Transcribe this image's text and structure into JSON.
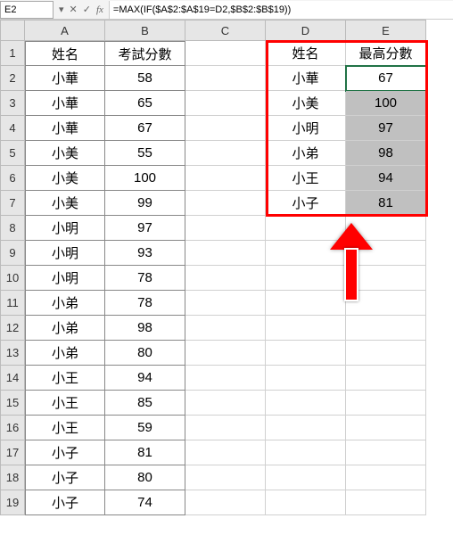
{
  "namebox": "E2",
  "formula": "=MAX(IF($A$2:$A$19=D2,$B$2:$B$19))",
  "columns": [
    "A",
    "B",
    "C",
    "D",
    "E"
  ],
  "rows": [
    "1",
    "2",
    "3",
    "4",
    "5",
    "6",
    "7",
    "8",
    "9",
    "10",
    "11",
    "12",
    "13",
    "14",
    "15",
    "16",
    "17",
    "18",
    "19"
  ],
  "A": {
    "1": "姓名",
    "2": "小華",
    "3": "小華",
    "4": "小華",
    "5": "小美",
    "6": "小美",
    "7": "小美",
    "8": "小明",
    "9": "小明",
    "10": "小明",
    "11": "小弟",
    "12": "小弟",
    "13": "小弟",
    "14": "小王",
    "15": "小王",
    "16": "小王",
    "17": "小子",
    "18": "小子",
    "19": "小子"
  },
  "B": {
    "1": "考試分數",
    "2": "58",
    "3": "65",
    "4": "67",
    "5": "55",
    "6": "100",
    "7": "99",
    "8": "97",
    "9": "93",
    "10": "78",
    "11": "78",
    "12": "98",
    "13": "80",
    "14": "94",
    "15": "85",
    "16": "59",
    "17": "81",
    "18": "80",
    "19": "74"
  },
  "D": {
    "1": "姓名",
    "2": "小華",
    "3": "小美",
    "4": "小明",
    "5": "小弟",
    "6": "小王",
    "7": "小子"
  },
  "E": {
    "1": "最高分數",
    "2": "67",
    "3": "100",
    "4": "97",
    "5": "98",
    "6": "94",
    "7": "81"
  },
  "chart_data": {
    "type": "table",
    "title": "最高分數 per 姓名 via MAX(IF array formula)",
    "source_table": {
      "columns": [
        "姓名",
        "考試分數"
      ],
      "rows": [
        [
          "小華",
          58
        ],
        [
          "小華",
          65
        ],
        [
          "小華",
          67
        ],
        [
          "小美",
          55
        ],
        [
          "小美",
          100
        ],
        [
          "小美",
          99
        ],
        [
          "小明",
          97
        ],
        [
          "小明",
          93
        ],
        [
          "小明",
          78
        ],
        [
          "小弟",
          78
        ],
        [
          "小弟",
          98
        ],
        [
          "小弟",
          80
        ],
        [
          "小王",
          94
        ],
        [
          "小王",
          85
        ],
        [
          "小王",
          59
        ],
        [
          "小子",
          81
        ],
        [
          "小子",
          80
        ],
        [
          "小子",
          74
        ]
      ]
    },
    "result_table": {
      "columns": [
        "姓名",
        "最高分數"
      ],
      "rows": [
        [
          "小華",
          67
        ],
        [
          "小美",
          100
        ],
        [
          "小明",
          97
        ],
        [
          "小弟",
          98
        ],
        [
          "小王",
          94
        ],
        [
          "小子",
          81
        ]
      ]
    }
  }
}
